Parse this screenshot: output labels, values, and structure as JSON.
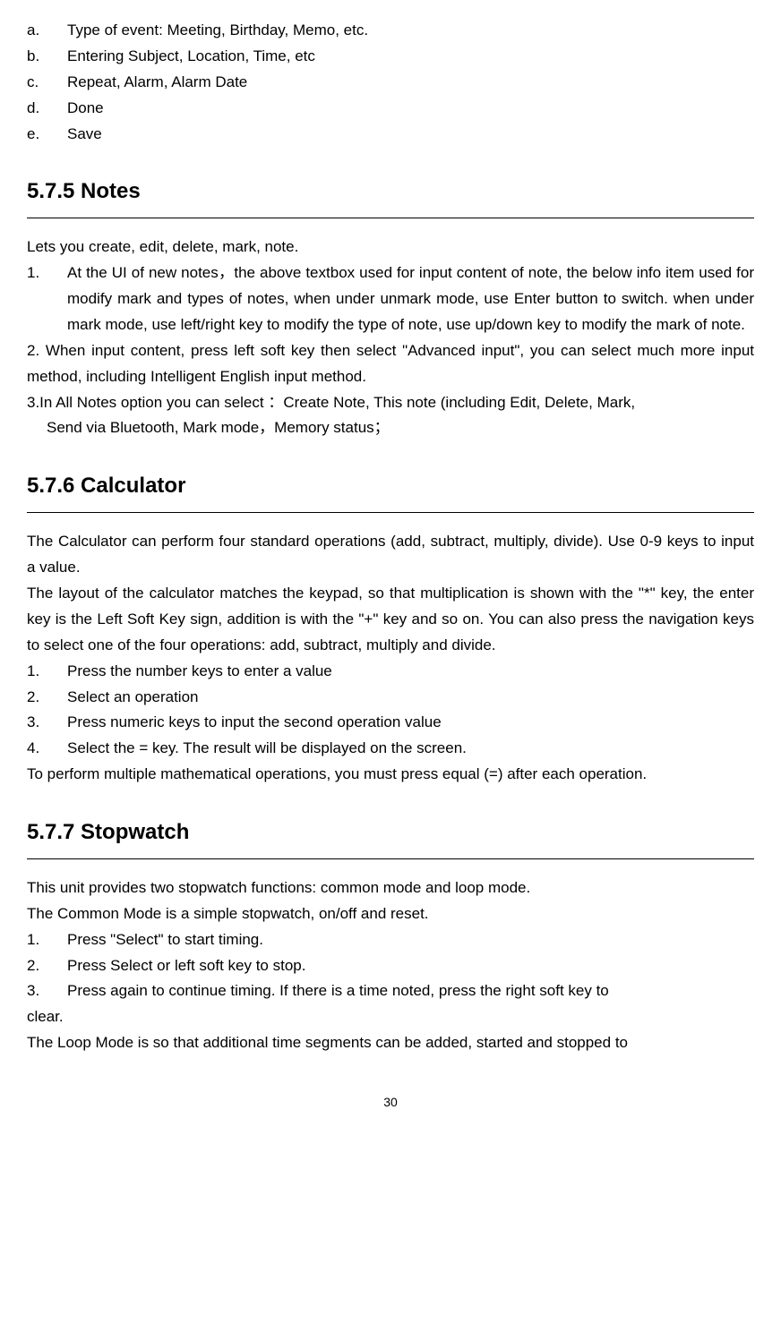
{
  "topList": {
    "a": {
      "marker": "a.",
      "text": "Type of event: Meeting, Birthday, Memo, etc."
    },
    "b": {
      "marker": "b.",
      "text": "Entering Subject, Location, Time, etc"
    },
    "c": {
      "marker": "c.",
      "text": "Repeat, Alarm, Alarm Date"
    },
    "d": {
      "marker": "d.",
      "text": "Done"
    },
    "e": {
      "marker": "e.",
      "text": "Save"
    }
  },
  "sections": {
    "notes": {
      "heading": "5.7.5 Notes",
      "intro": "Lets you create, edit, delete, mark, note.",
      "item1": {
        "marker": "1.",
        "text": "At the UI of new notes，the above textbox used for input content of note, the below info item used for modify mark and types of notes, when under unmark mode, use Enter button to switch. when under mark mode, use left/right key to modify the type of note, use up/down key to modify the mark of note."
      },
      "item2": "2. When input content, press left soft key then select \"Advanced input\", you can select much more input method, including Intelligent English input method.",
      "item3a": "3.In All Notes option you can select ：Create Note, This note (including Edit, Delete, Mark,",
      "item3b": "Send via Bluetooth, Mark mode，Memory status；"
    },
    "calculator": {
      "heading": "5.7.6 Calculator",
      "p1": "The Calculator can perform four standard operations (add, subtract, multiply, divide). Use 0-9 keys to input a value.",
      "p2": "The layout of the calculator matches the keypad, so that multiplication is shown with the \"*\" key, the enter key is the Left Soft Key sign, addition is with the \"+\" key and so on. You can also press the navigation keys to select one of the four operations: add, subtract, multiply and divide.",
      "item1": {
        "marker": "1.",
        "text": "Press the number keys to enter a value"
      },
      "item2": {
        "marker": "2.",
        "text": "Select an operation"
      },
      "item3": {
        "marker": "3.",
        "text": "Press numeric keys to input the second operation value"
      },
      "item4": {
        "marker": "4.",
        "text": "Select the = key. The result will be displayed on the screen."
      },
      "p3": "To perform multiple mathematical operations, you must press equal (=) after each operation."
    },
    "stopwatch": {
      "heading": "5.7.7 Stopwatch",
      "p1": "This unit provides two stopwatch functions: common mode and loop mode.",
      "p2": "The Common Mode is a simple stopwatch, on/off and reset.",
      "item1": {
        "marker": "1.",
        "text": "Press \"Select\" to start timing."
      },
      "item2": {
        "marker": "2.",
        "text": "Press Select or left soft key to stop."
      },
      "item3": {
        "marker": "3.",
        "text": "Press again to continue timing.  If there is a time noted, press the right soft key to"
      },
      "item3cont": "clear.",
      "p3": "The Loop Mode is so that additional time segments can be added, started and stopped to"
    }
  },
  "pageNumber": "30"
}
